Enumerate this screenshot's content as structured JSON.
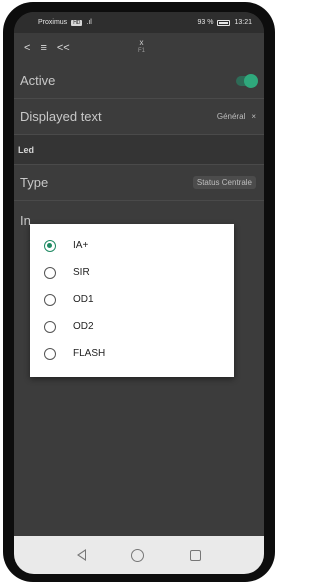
{
  "statusbar": {
    "carrier": "Proximus",
    "badge": "HD",
    "signal": ".ıl",
    "battery_percent": "93 %",
    "time": "13:21"
  },
  "toolbar": {
    "back": "<",
    "menu": "≡",
    "collapse": "<<",
    "close": "x",
    "subtitle": "F1"
  },
  "settings": {
    "active_label": "Active",
    "active_on": true,
    "displayed_text_label": "Displayed text",
    "displayed_text_value": "Général",
    "section_led": "Led",
    "type_label": "Type",
    "type_value": "Status Centrale",
    "partial_label": "In"
  },
  "dialog": {
    "options": [
      "IA+",
      "SIR",
      "OD1",
      "OD2",
      "FLASH"
    ],
    "selected_index": 0
  },
  "colors": {
    "accent": "#1f8a63",
    "overlay": "#3c3c3c",
    "navbar": "#eaeaea"
  },
  "icons": [
    "back-icon",
    "menu-icon",
    "collapse-icon",
    "close-icon",
    "battery-icon",
    "nav-back-icon",
    "nav-home-icon",
    "nav-recent-icon"
  ]
}
